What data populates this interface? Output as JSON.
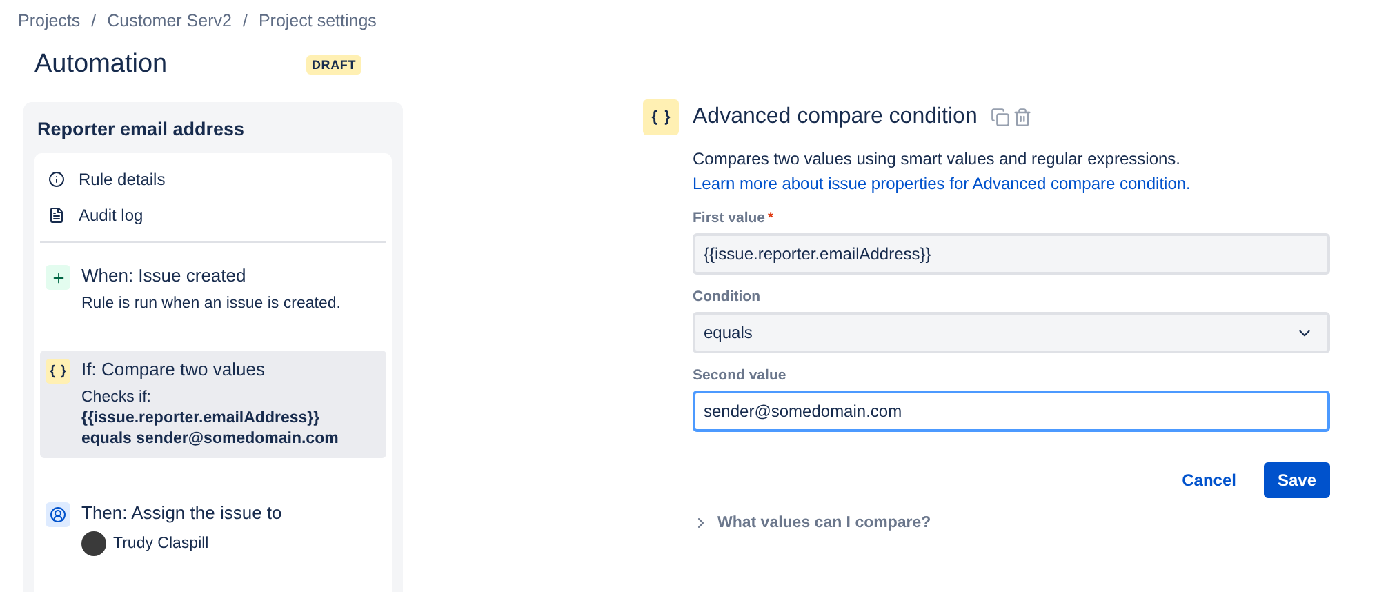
{
  "breadcrumbs": [
    {
      "label": "Projects"
    },
    {
      "separator": "/",
      "label": "Customer Serv2"
    },
    {
      "separator": "/",
      "label": "Project settings"
    }
  ],
  "page_title": "Automation",
  "status_badge": "DRAFT",
  "rule": {
    "name": "Reporter email address",
    "links": [
      {
        "kind": "info",
        "label": "Rule details"
      },
      {
        "kind": "log",
        "label": "Audit log"
      }
    ],
    "steps": [
      {
        "kind": "trigger",
        "title": "When: Issue created",
        "description": "Rule is run when an issue is created.",
        "selected": false
      },
      {
        "kind": "condition",
        "title": "If: Compare two values",
        "description": "Checks if:\n**{{issue.reporter.emailAddress}}\nequals sender@somedomain.com**",
        "selected": true
      },
      {
        "kind": "action",
        "title": "Then: Assign the issue to",
        "assignee": "Trudy Claspill",
        "selected": false
      }
    ]
  },
  "editor": {
    "title": "Advanced compare condition",
    "description": "Compares two values using smart values and regular expressions.",
    "link": "Learn more about issue properties for Advanced compare condition.",
    "fields": [
      {
        "kind": "text",
        "label": "First value",
        "required_mark": "*",
        "value": "{{issue.reporter.emailAddress}}",
        "focused": false
      },
      {
        "kind": "select",
        "label": "Condition",
        "value": "equals",
        "focused": false
      },
      {
        "kind": "text",
        "label": "Second value",
        "value": "sender@somedomain.com",
        "focused": true
      }
    ],
    "buttons": {
      "cancel": "Cancel",
      "save": "Save"
    },
    "help_toggle": {
      "label": "What values can I compare?",
      "expanded": false
    }
  }
}
